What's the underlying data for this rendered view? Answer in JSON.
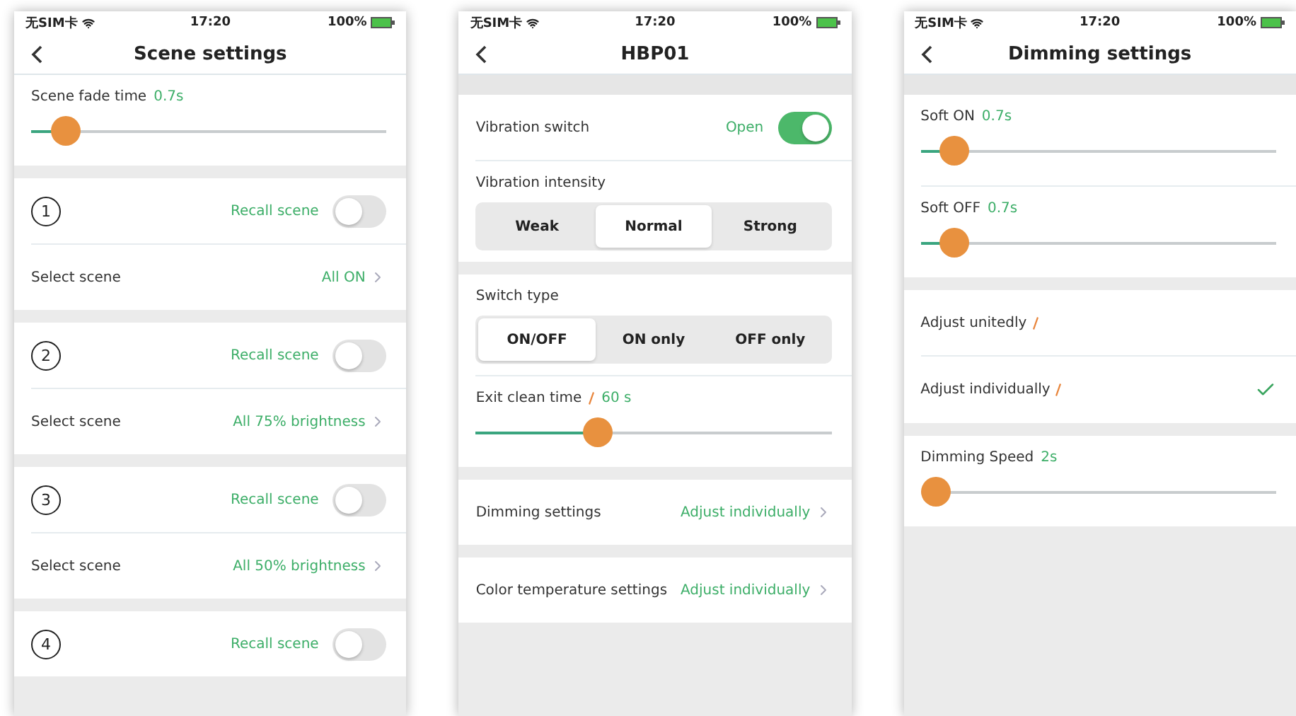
{
  "screens": [
    {
      "status": {
        "carrier": "无SIM卡",
        "time": "17:20",
        "battery": "100%"
      },
      "title": "Scene settings",
      "top_gap": false,
      "sections": [
        {
          "items": [
            {
              "kind": "slider",
              "label": "Scene fade time",
              "value": "0.7s",
              "level": 0.06
            }
          ]
        },
        {
          "items": [
            {
              "kind": "scene",
              "number": "1",
              "label": "Recall scene",
              "on": false
            },
            {
              "kind": "link",
              "label": "Select scene",
              "value": "All ON"
            }
          ]
        },
        {
          "items": [
            {
              "kind": "scene",
              "number": "2",
              "label": "Recall scene",
              "on": false
            },
            {
              "kind": "link",
              "label": "Select scene",
              "value": "All 75% brightness"
            }
          ]
        },
        {
          "items": [
            {
              "kind": "scene",
              "number": "3",
              "label": "Recall scene",
              "on": false
            },
            {
              "kind": "link",
              "label": "Select scene",
              "value": "All 50% brightness"
            }
          ]
        },
        {
          "items": [
            {
              "kind": "scene",
              "number": "4",
              "label": "Recall scene",
              "on": false
            }
          ]
        }
      ]
    },
    {
      "status": {
        "carrier": "无SIM卡",
        "time": "17:20",
        "battery": "100%"
      },
      "title": "HBP01",
      "top_gap": true,
      "sections": [
        {
          "items": [
            {
              "kind": "switch",
              "label": "Vibration switch",
              "value": "Open",
              "on": true
            },
            {
              "kind": "segmented",
              "label": "Vibration intensity",
              "options": [
                {
                  "label": "Weak",
                  "selected": false
                },
                {
                  "label": "Normal",
                  "selected": true
                },
                {
                  "label": "Strong",
                  "selected": false
                }
              ]
            }
          ]
        },
        {
          "items": [
            {
              "kind": "segmented",
              "label": "Switch type",
              "options": [
                {
                  "label": "ON/OFF",
                  "selected": true
                },
                {
                  "label": "ON only",
                  "selected": false
                },
                {
                  "label": "OFF only",
                  "selected": false
                }
              ]
            },
            {
              "kind": "slider",
              "label": "Exit clean time",
              "value": "60 s",
              "level": 0.33,
              "edit": true
            }
          ]
        },
        {
          "items": [
            {
              "kind": "link",
              "label": "Dimming settings",
              "value": "Adjust individually"
            }
          ]
        },
        {
          "items": [
            {
              "kind": "link",
              "label": "Color temperature settings",
              "value": "Adjust individually"
            }
          ]
        }
      ]
    },
    {
      "status": {
        "carrier": "无SIM卡",
        "time": "17:20",
        "battery": "100%"
      },
      "title": "Dimming settings",
      "top_gap": true,
      "sections": [
        {
          "items": [
            {
              "kind": "slider",
              "label": "Soft ON",
              "value": "0.7s",
              "level": 0.06
            },
            {
              "kind": "slider",
              "label": "Soft OFF",
              "value": "0.7s",
              "level": 0.06
            }
          ]
        },
        {
          "items": [
            {
              "kind": "option",
              "label": "Adjust unitedly",
              "edit": true,
              "checked": false
            },
            {
              "kind": "option",
              "label": "Adjust individually",
              "edit": true,
              "checked": true
            }
          ]
        },
        {
          "items": [
            {
              "kind": "slider",
              "label": "Dimming Speed",
              "value": "2s",
              "level": 0.0
            }
          ]
        }
      ]
    }
  ]
}
